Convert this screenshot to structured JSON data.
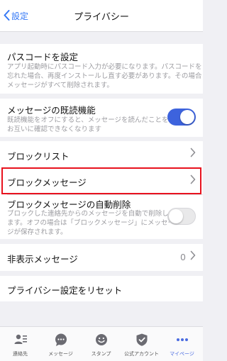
{
  "nav": {
    "back_label": "設定",
    "title": "プライバシー"
  },
  "passcode": {
    "label": "パスコードを設定",
    "description_lines": [
      "アプリ起動時にパスコード入力が必要になります。パスコードを",
      "忘れた場合、再度インストールし直す必要があります。その場合",
      "メッセージがすべて削除されます。"
    ]
  },
  "read_receipts": {
    "label": "メッセージの既読機能",
    "description_lines": [
      "既読機能をオフにすると、メッセージを読んだことを",
      "お互いに確認できなくなります"
    ],
    "enabled": true
  },
  "block_list": {
    "label": "ブロックリスト"
  },
  "block_message": {
    "label": "ブロックメッセージ"
  },
  "auto_delete": {
    "label": "ブロックメッセージの自動削除",
    "description_lines": [
      "ブロックした連絡先からのメッセージを自動で削除し",
      "ます。オフの場合は「ブロックメッセージ」にメッセー",
      "ジが保存されます。"
    ],
    "enabled": false
  },
  "hidden_messages": {
    "label": "非表示メッセージ",
    "count": "0"
  },
  "reset": {
    "label": "プライバシー設定をリセット"
  },
  "tabbar": {
    "items": [
      {
        "label": "連絡先",
        "icon": "contacts-icon"
      },
      {
        "label": "メッセージ",
        "icon": "chat-bubble-icon"
      },
      {
        "label": "スタンプ",
        "icon": "smiley-icon"
      },
      {
        "label": "公式アカウント",
        "icon": "shield-check-icon"
      },
      {
        "label": "マイページ",
        "icon": "more-dots-icon"
      }
    ],
    "active_index": 4
  },
  "colors": {
    "accent": "#3478f6",
    "toggle_on": "#3d63dd",
    "highlight": "#e8121e",
    "background": "#f0f0f4"
  }
}
